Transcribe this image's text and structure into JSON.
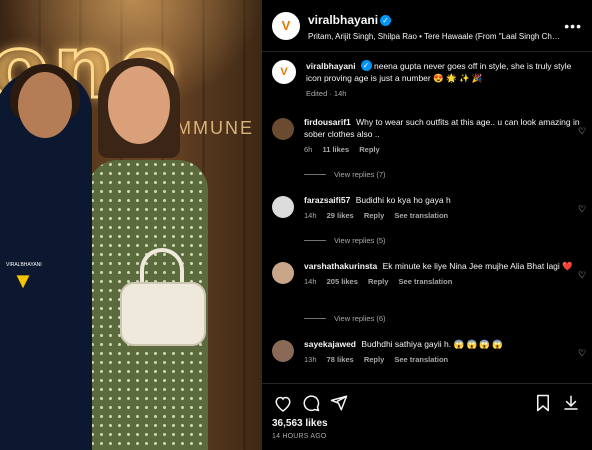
{
  "media": {
    "sign_text": "one",
    "sub_sign": "MMUNE",
    "watermark": "VIRALBHAYANI"
  },
  "header": {
    "username": "viralbhayani",
    "verified": true,
    "audio": "Pritam, Arijit Singh, Shilpa Rao • Tere Hawaale (From \"Laal Singh Chad...",
    "more_icon": "more-horizontal-icon"
  },
  "caption": {
    "username": "viralbhayani",
    "text": "neena gupta never goes off in style, she is truly style icon proving age is just a number 😍 🌟 ✨ 🎉",
    "edited": "Edited · 14h"
  },
  "comments": [
    {
      "username": "firdousarif1",
      "text": "Why to wear such outfits at this age.. u can look amazing in sober clothes also ..",
      "time": "6h",
      "likes": "11 likes",
      "reply": "Reply",
      "translation": "",
      "view_replies": "View replies (7)",
      "avatar_color": "#6b4b2f"
    },
    {
      "username": "farazsaifi57",
      "text": "Budidhi ko kya ho gaya h",
      "time": "14h",
      "likes": "29 likes",
      "reply": "Reply",
      "translation": "See translation",
      "view_replies": "View replies (5)",
      "avatar_color": "#dcdcdc"
    },
    {
      "username": "varshathakurinsta",
      "text": "Ek minute ke liye Nina Jee mujhe Alia Bhat lagi ❤️",
      "time": "14h",
      "likes": "205 likes",
      "reply": "Reply",
      "translation": "See translation",
      "view_replies": "View replies (6)",
      "avatar_color": "#c9a58a"
    },
    {
      "username": "sayekajawed",
      "text": "Budhdhi sathiya gayii h. 😱 😱 😱 😱",
      "time": "13h",
      "likes": "78 likes",
      "reply": "Reply",
      "translation": "See translation",
      "view_replies": "",
      "avatar_color": "#8a6a56"
    }
  ],
  "actions": {
    "likes": "36,563 likes",
    "time_ago": "14 HOURS AGO"
  },
  "colors": {
    "background": "#000000",
    "text": "#f5f5f5",
    "secondary": "#a8a8a8",
    "verified": "#0095f6"
  }
}
